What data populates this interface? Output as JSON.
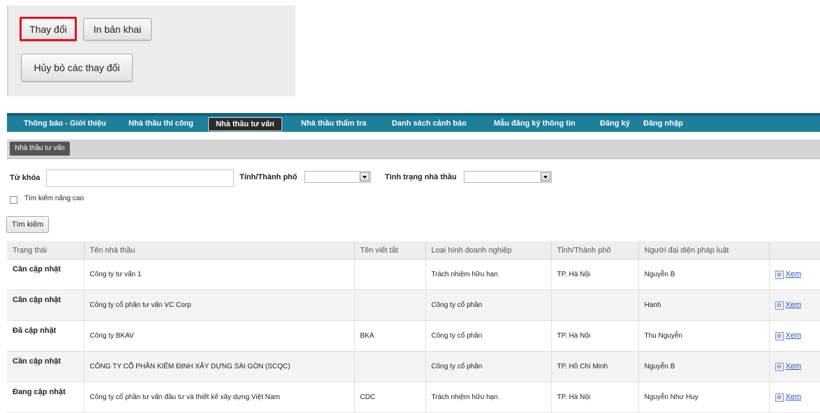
{
  "actions": {
    "change_label": "Thay đổi",
    "print_label": "In bản khai",
    "cancel_label": "Hủy bỏ các thay đổi"
  },
  "nav": {
    "items": [
      {
        "label": "Thông báo - Giới thiệu"
      },
      {
        "label": "Nhà thầu thi công"
      },
      {
        "label": "Nhà thầu tư vấn"
      },
      {
        "label": "Nhà thầu thẩm tra"
      },
      {
        "label": "Danh sách cảnh báo"
      },
      {
        "label": "Mẫu đăng ký thông tin"
      },
      {
        "label": "Đăng ký"
      },
      {
        "label": "Đăng nhập"
      }
    ],
    "active_index": 2,
    "bar_color": "#1e7f9b"
  },
  "subtab": {
    "label": "Nhà thầu tư vấn"
  },
  "search": {
    "keyword_label": "Từ khóa",
    "keyword_value": "",
    "province_label": "Tỉnh/Thành phố",
    "province_value": "",
    "status_label": "Tình trạng nhà thầu",
    "status_value": "",
    "advanced_label": "Tìm kiếm nâng cao",
    "advanced_checked": false,
    "search_button": "Tìm kiếm"
  },
  "table": {
    "headers": [
      "Trạng thái",
      "Tên nhà thầu",
      "Tên viết tắt",
      "Loại hình doanh nghiệp",
      "Tỉnh/Thành phố",
      "Người đại diện pháp luật",
      ""
    ],
    "view_label": "Xem",
    "rows": [
      {
        "status": "Cần cập nhật",
        "status_color": "#ee1c1c",
        "name": "Công ty tư vấn 1",
        "abbr": "",
        "type": "Trách nhiệm hữu hạn",
        "province": "TP. Hà Nội",
        "rep": "Nguyễn B"
      },
      {
        "status": "Cần cập nhật",
        "status_color": "#ee1c1c",
        "name": "Công ty cổ phần tư vấn VC Corp",
        "abbr": "",
        "type": "Công ty cổ phần",
        "province": "",
        "rep": "Hanh"
      },
      {
        "status": "Đã cập nhật",
        "status_color": "#222222",
        "name": "Công ty BKAV",
        "abbr": "BKA",
        "type": "Công ty cổ phần",
        "province": "TP. Hà Nội",
        "rep": "Thu Nguyễn"
      },
      {
        "status": "Cần cập nhật",
        "status_color": "#ee1c1c",
        "name": "CÔNG TY CỔ PHẦN KIỂM ĐỊNH XÂY DỰNG SÀI GÒN (SCQC)",
        "abbr": "",
        "type": "Công ty cổ phần",
        "province": "TP. Hồ Chí Minh",
        "rep": "Nguyễn B"
      },
      {
        "status": "Đang cập nhật",
        "status_color": "#5fcf26",
        "name": "Công ty cổ phần tư vấn đầu tư và thiết kế xây dựng Việt Nam",
        "abbr": "CDC",
        "type": "Trách nhiệm hữu hạn",
        "province": "TP. Hà Nội",
        "rep": "Nguyễn Như Huy"
      }
    ]
  }
}
